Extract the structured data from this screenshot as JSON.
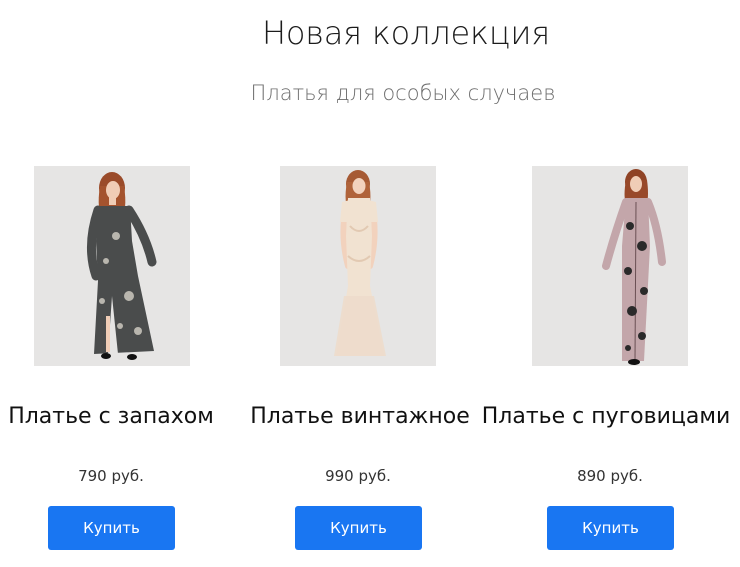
{
  "header": {
    "title": "Новая коллекция",
    "subtitle": "Платья для особых случаев"
  },
  "products": [
    {
      "name": "Платье с запахом",
      "price": "790 руб.",
      "buy_label": "Купить",
      "dress_color": "#4a4c4c",
      "pattern_color": "#b9b6ae"
    },
    {
      "name": "Платье винтажное",
      "price": "990 руб.",
      "buy_label": "Купить",
      "dress_color": "#f1e2d1",
      "pattern_color": "#e8d2bd"
    },
    {
      "name": "Платье с пуговицами",
      "price": "890 руб.",
      "buy_label": "Купить",
      "dress_color": "#c3a6aa",
      "pattern_color": "#2a2a2a"
    }
  ],
  "colors": {
    "button": "#1976f2",
    "photo_background": "#e5e4e3"
  }
}
